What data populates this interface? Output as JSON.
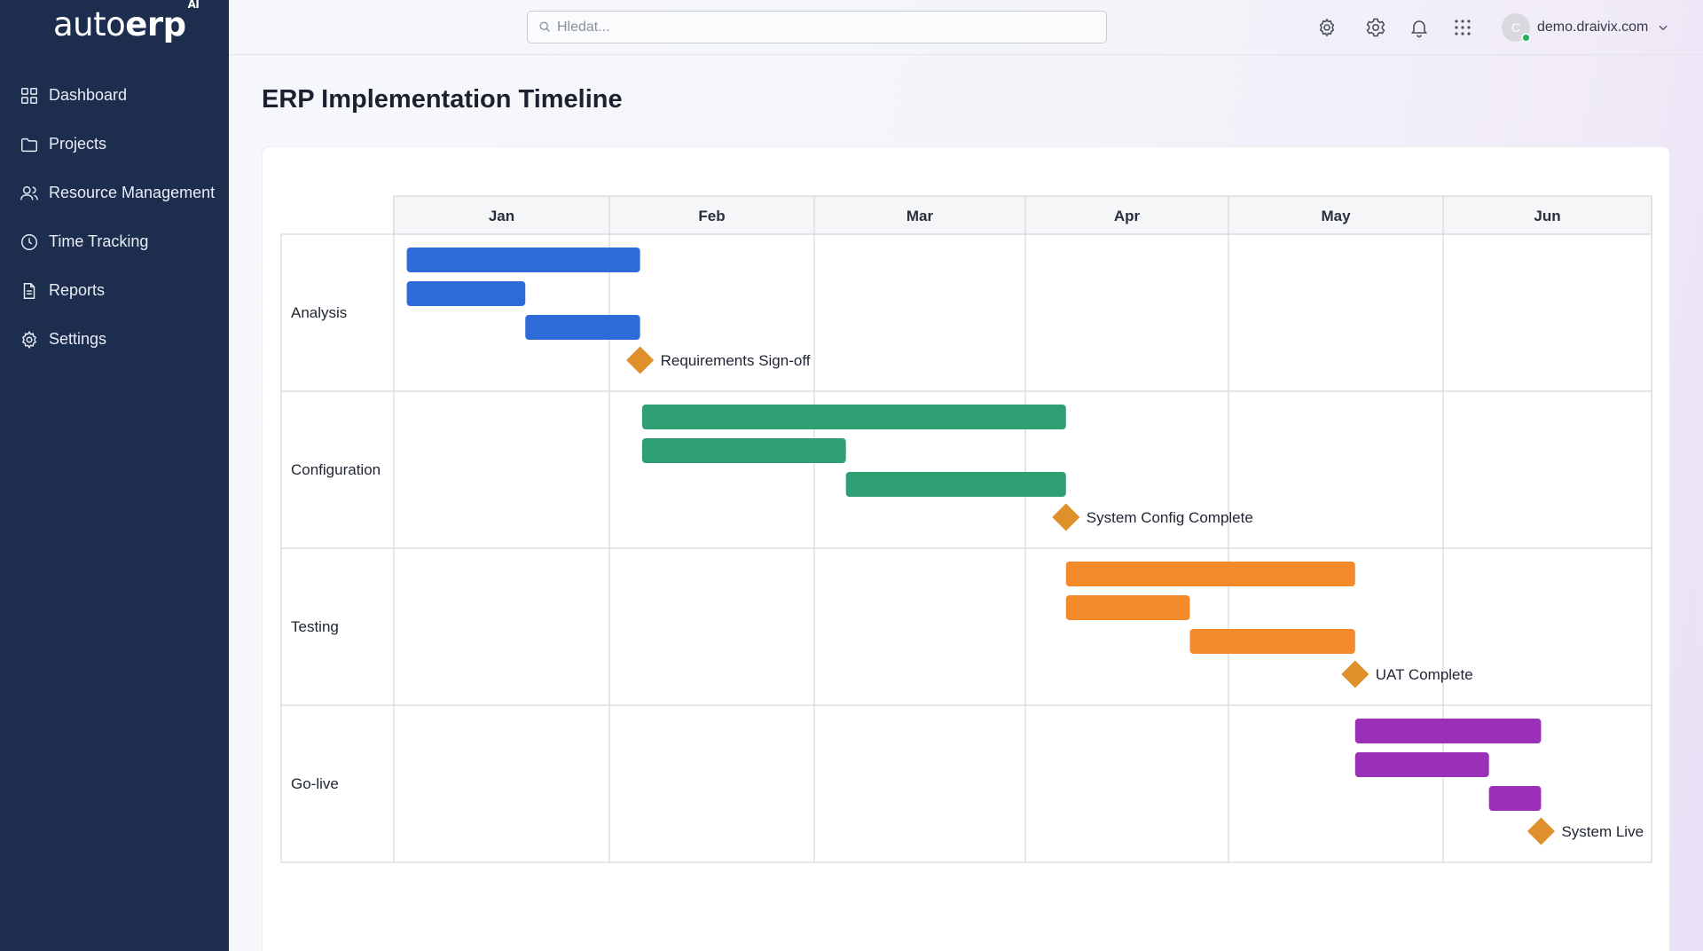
{
  "app": {
    "logo_main": "auto",
    "logo_bold": "erp",
    "logo_sup": "AI"
  },
  "sidebar": {
    "items": [
      {
        "label": "Dashboard",
        "icon": "grid-icon"
      },
      {
        "label": "Projects",
        "icon": "folder-icon"
      },
      {
        "label": "Resource Management",
        "icon": "users-icon"
      },
      {
        "label": "Time Tracking",
        "icon": "clock-icon"
      },
      {
        "label": "Reports",
        "icon": "document-icon"
      },
      {
        "label": "Settings",
        "icon": "gear-icon"
      }
    ]
  },
  "header": {
    "search_placeholder": "Hledat...",
    "user_initial": "C",
    "user_email": "demo.draivix.com"
  },
  "page": {
    "title": "ERP Implementation Timeline"
  },
  "colors": {
    "sidebar_bg": "#1d2d4d",
    "analysis": "#2f6bd8",
    "configuration": "#2f9f74",
    "testing": "#f48a2a",
    "golive": "#9a2fb8",
    "milestone": "#e0902a",
    "online": "#22b15a"
  },
  "chart_data": {
    "type": "gantt",
    "months": [
      "Jan",
      "Feb",
      "Mar",
      "Apr",
      "May",
      "Jun"
    ],
    "phases": [
      {
        "name": "Analysis",
        "color": "#2f6bd8",
        "tasks": [
          [
            0.06,
            1.15
          ],
          [
            0.06,
            0.61
          ],
          [
            0.61,
            1.15
          ]
        ],
        "milestone": {
          "label": "Requirements Sign-off",
          "at": 1.15
        }
      },
      {
        "name": "Configuration",
        "color": "#2f9f74",
        "tasks": [
          [
            1.16,
            3.2
          ],
          [
            1.16,
            2.15
          ],
          [
            2.15,
            3.2
          ]
        ],
        "milestone": {
          "label": "System Config Complete",
          "at": 3.2
        }
      },
      {
        "name": "Testing",
        "color": "#f48a2a",
        "tasks": [
          [
            3.2,
            4.59
          ],
          [
            3.2,
            3.81
          ],
          [
            3.81,
            4.59
          ]
        ],
        "milestone": {
          "label": "UAT Complete",
          "at": 4.59
        }
      },
      {
        "name": "Go-live",
        "color": "#9a2fb8",
        "tasks": [
          [
            4.59,
            5.47
          ],
          [
            4.59,
            5.22
          ],
          [
            5.22,
            5.47
          ]
        ],
        "milestone": {
          "label": "System Live",
          "at": 5.47
        }
      }
    ]
  }
}
